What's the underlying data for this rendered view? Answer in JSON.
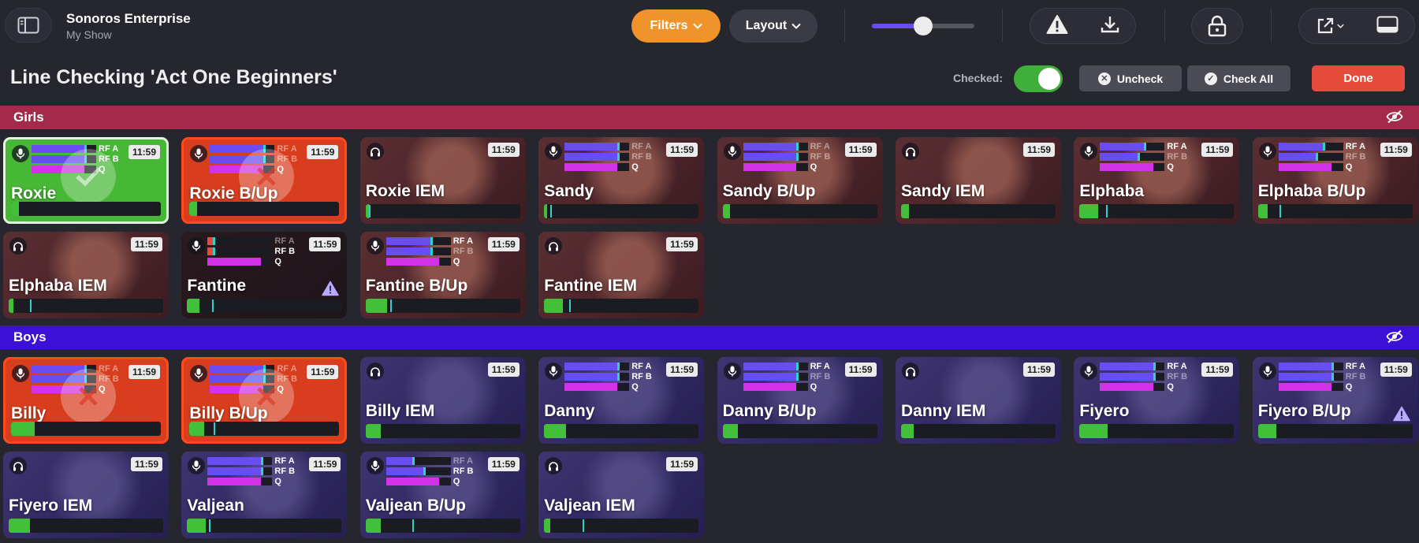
{
  "app": {
    "title": "Sonoros Enterprise",
    "subtitle": "My Show"
  },
  "toolbar": {
    "filters_label": "Filters",
    "layout_label": "Layout",
    "zoom_level": 0.5,
    "icons": [
      "sidebar-toggle-icon",
      "warning-icon",
      "download-icon",
      "lock-icon",
      "external-open-icon",
      "panel-icon"
    ]
  },
  "header": {
    "title": "Line Checking 'Act One Beginners'",
    "checked_label": "Checked:",
    "checked_on": true,
    "uncheck_label": "Uncheck",
    "check_all_label": "Check All",
    "done_label": "Done"
  },
  "colors": {
    "girls_group": "#a32a4a",
    "boys_group": "#3b11d6",
    "accent_orange": "#f0932b",
    "done_red": "#e64c3c",
    "checked_green": "#47b835",
    "error_red": "#d83e1e",
    "meter_purple": "#6a4cf5",
    "meter_magenta": "#d232e8"
  },
  "meter_labels": {
    "a": "RF A",
    "b": "RF B",
    "q": "Q"
  },
  "groups": [
    {
      "name": "Girls",
      "tiles": [
        {
          "name": "Roxie",
          "kind": "mic",
          "time": "11:59",
          "state": "checked",
          "photo": "none",
          "rf_a": 0.82,
          "rf_b": 0.82,
          "q": 0.82,
          "lit": [
            "a",
            "b",
            "q"
          ],
          "level": 0.05,
          "peak": 0,
          "warning": false
        },
        {
          "name": "Roxie B/Up",
          "kind": "mic",
          "time": "11:59",
          "state": "error",
          "photo": "none",
          "rf_a": 0.82,
          "rf_b": 0.82,
          "q": 0.82,
          "lit": [
            "q"
          ],
          "level": 0.05,
          "peak": 0,
          "warning": false
        },
        {
          "name": "Roxie IEM",
          "kind": "iem",
          "time": "11:59",
          "state": "normal",
          "photo": "girls",
          "level": 0.02,
          "peak": 0.02,
          "warning": false
        },
        {
          "name": "Sandy",
          "kind": "mic",
          "time": "11:59",
          "state": "normal",
          "photo": "girls",
          "rf_a": 0.82,
          "rf_b": 0.82,
          "q": 0.82,
          "lit": [
            "q"
          ],
          "level": 0.02,
          "peak": 0.04,
          "warning": false
        },
        {
          "name": "Sandy B/Up",
          "kind": "mic",
          "time": "11:59",
          "state": "normal",
          "photo": "girls",
          "rf_a": 0.82,
          "rf_b": 0.82,
          "q": 0.82,
          "lit": [
            "q"
          ],
          "level": 0.05,
          "peak": 0,
          "warning": false
        },
        {
          "name": "Sandy IEM",
          "kind": "iem",
          "time": "11:59",
          "state": "normal",
          "photo": "girls",
          "level": 0.05,
          "peak": 0,
          "warning": false
        },
        {
          "name": "Elphaba",
          "kind": "mic",
          "time": "11:59",
          "state": "normal",
          "photo": "girls",
          "rf_a": 0.68,
          "rf_b": 0.58,
          "q": 0.82,
          "lit": [
            "a",
            "q"
          ],
          "level": 0.12,
          "peak": 0.17,
          "warning": false
        },
        {
          "name": "Elphaba B/Up",
          "kind": "mic",
          "time": "11:59",
          "state": "normal",
          "photo": "girls",
          "rf_a": 0.68,
          "rf_b": 0.58,
          "q": 0.82,
          "lit": [
            "a",
            "q"
          ],
          "level": 0.06,
          "peak": 0.14,
          "warning": false
        },
        {
          "name": "Elphaba IEM",
          "kind": "iem",
          "time": "11:59",
          "state": "normal",
          "photo": "girls",
          "level": 0.03,
          "peak": 0.14,
          "warning": false
        },
        {
          "name": "Fantine",
          "kind": "mic",
          "time": "11:59",
          "state": "normal",
          "photo": "dark",
          "rf_a": 0.08,
          "rf_b": 0.08,
          "q": 0.82,
          "lit": [
            "b",
            "q"
          ],
          "level": 0.08,
          "peak": 0.16,
          "warning": true
        },
        {
          "name": "Fantine B/Up",
          "kind": "mic",
          "time": "11:59",
          "state": "normal",
          "photo": "girls",
          "rf_a": 0.68,
          "rf_b": 0.68,
          "q": 0.82,
          "lit": [
            "a",
            "q"
          ],
          "level": 0.14,
          "peak": 0.16,
          "warning": false
        },
        {
          "name": "Fantine IEM",
          "kind": "iem",
          "time": "11:59",
          "state": "normal",
          "photo": "girls",
          "level": 0.12,
          "peak": 0.16,
          "warning": false
        }
      ]
    },
    {
      "name": "Boys",
      "tiles": [
        {
          "name": "Billy",
          "kind": "mic",
          "time": "11:59",
          "state": "error",
          "photo": "none",
          "rf_a": 0.82,
          "rf_b": 0.82,
          "q": 0.82,
          "lit": [
            "q"
          ],
          "level": 0.16,
          "peak": 0,
          "warning": false
        },
        {
          "name": "Billy B/Up",
          "kind": "mic",
          "time": "11:59",
          "state": "error",
          "photo": "none",
          "rf_a": 0.82,
          "rf_b": 0.82,
          "q": 0.82,
          "lit": [
            "q"
          ],
          "level": 0.1,
          "peak": 0.16,
          "warning": false
        },
        {
          "name": "Billy IEM",
          "kind": "iem",
          "time": "11:59",
          "state": "normal",
          "photo": "boys",
          "level": 0.1,
          "peak": 0,
          "warning": false
        },
        {
          "name": "Danny",
          "kind": "mic",
          "time": "11:59",
          "state": "normal",
          "photo": "boys",
          "rf_a": 0.82,
          "rf_b": 0.82,
          "q": 0.82,
          "lit": [
            "a",
            "b",
            "q"
          ],
          "level": 0.14,
          "peak": 0,
          "warning": false
        },
        {
          "name": "Danny B/Up",
          "kind": "mic",
          "time": "11:59",
          "state": "normal",
          "photo": "boys",
          "rf_a": 0.82,
          "rf_b": 0.82,
          "q": 0.82,
          "lit": [
            "a",
            "q"
          ],
          "level": 0.1,
          "peak": 0,
          "warning": false
        },
        {
          "name": "Danny IEM",
          "kind": "iem",
          "time": "11:59",
          "state": "normal",
          "photo": "boys",
          "level": 0.08,
          "peak": 0,
          "warning": false
        },
        {
          "name": "Fiyero",
          "kind": "mic",
          "time": "11:59",
          "state": "normal",
          "photo": "boys",
          "rf_a": 0.82,
          "rf_b": 0.82,
          "q": 0.82,
          "lit": [
            "a",
            "q"
          ],
          "level": 0.18,
          "peak": 0,
          "warning": false
        },
        {
          "name": "Fiyero B/Up",
          "kind": "mic",
          "time": "11:59",
          "state": "normal",
          "photo": "boys",
          "rf_a": 0.82,
          "rf_b": 0.82,
          "q": 0.82,
          "lit": [
            "a",
            "q"
          ],
          "level": 0.12,
          "peak": 0,
          "warning": true
        },
        {
          "name": "Fiyero IEM",
          "kind": "iem",
          "time": "11:59",
          "state": "normal",
          "photo": "boys",
          "level": 0.14,
          "peak": 0,
          "warning": false
        },
        {
          "name": "Valjean",
          "kind": "mic",
          "time": "11:59",
          "state": "normal",
          "photo": "boys",
          "rf_a": 0.82,
          "rf_b": 0.82,
          "q": 0.82,
          "lit": [
            "a",
            "b",
            "q"
          ],
          "level": 0.12,
          "peak": 0.14,
          "warning": false
        },
        {
          "name": "Valjean B/Up",
          "kind": "mic",
          "time": "11:59",
          "state": "normal",
          "photo": "boys",
          "rf_a": 0.4,
          "rf_b": 0.58,
          "q": 0.82,
          "lit": [
            "b",
            "q"
          ],
          "level": 0.1,
          "peak": 0.3,
          "warning": false
        },
        {
          "name": "Valjean IEM",
          "kind": "iem",
          "time": "11:59",
          "state": "normal",
          "photo": "boys",
          "level": 0.04,
          "peak": 0.25,
          "warning": false
        }
      ]
    }
  ]
}
